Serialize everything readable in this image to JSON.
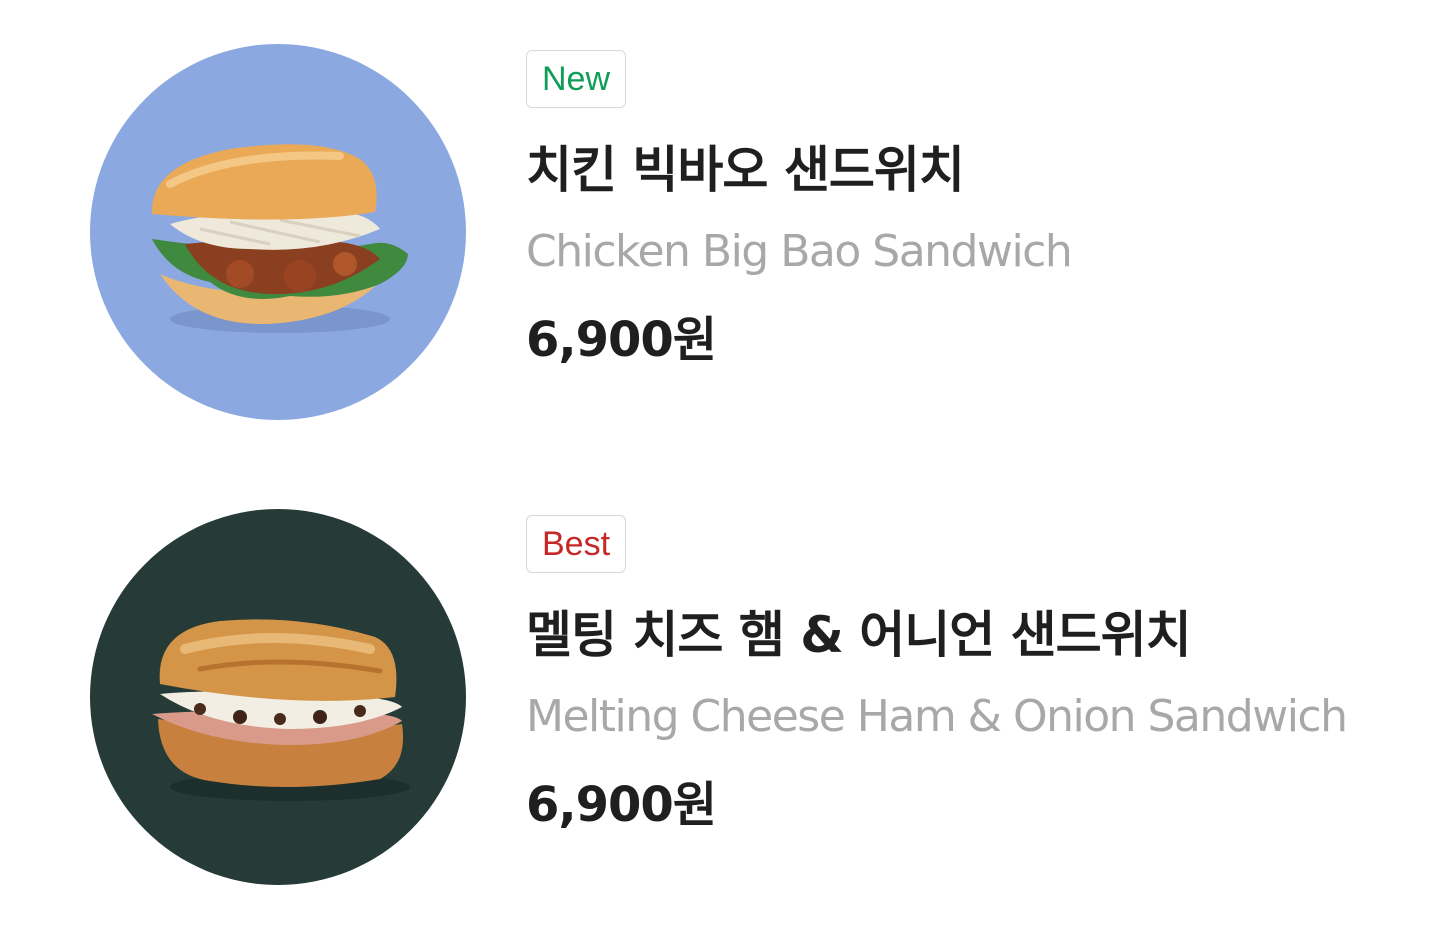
{
  "products": [
    {
      "badge": "New",
      "badge_color": "#0f9d58",
      "name_ko": "치킨 빅바오 샌드위치",
      "name_en": "Chicken Big Bao Sandwich",
      "price": "6,900원",
      "image_bg": "#8ba9e0",
      "image_icon": "chicken-bao-sandwich-image"
    },
    {
      "badge": "Best",
      "badge_color": "#c62828",
      "name_ko": "멜팅 치즈 햄 & 어니언 샌드위치",
      "name_en": "Melting Cheese Ham & Onion Sandwich",
      "price": "6,900원",
      "image_bg": "#263b37",
      "image_icon": "cheese-ham-onion-sandwich-image"
    }
  ]
}
